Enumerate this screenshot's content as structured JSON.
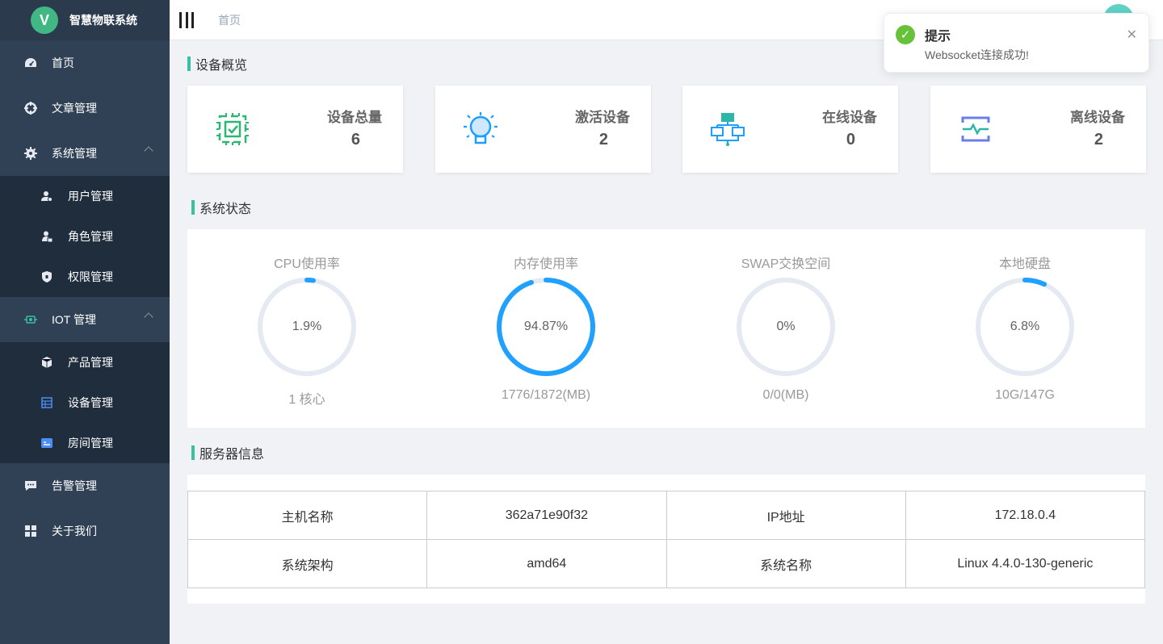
{
  "app": {
    "logo_letter": "V",
    "title": "智慧物联系统"
  },
  "sidebar": {
    "items": [
      {
        "label": "首页",
        "icon": "dashboard-icon"
      },
      {
        "label": "文章管理",
        "icon": "target-icon"
      },
      {
        "label": "系统管理",
        "icon": "gear-icon",
        "expanded": true,
        "children": [
          {
            "label": "用户管理",
            "icon": "user-icon"
          },
          {
            "label": "角色管理",
            "icon": "role-icon"
          },
          {
            "label": "权限管理",
            "icon": "shield-icon"
          }
        ]
      },
      {
        "label": "IOT 管理",
        "icon": "iot-icon",
        "expanded": true,
        "children": [
          {
            "label": "产品管理",
            "icon": "product-icon"
          },
          {
            "label": "设备管理",
            "icon": "device-icon"
          },
          {
            "label": "房间管理",
            "icon": "room-icon"
          }
        ]
      },
      {
        "label": "告警管理",
        "icon": "chat-icon"
      },
      {
        "label": "关于我们",
        "icon": "grid-icon"
      }
    ]
  },
  "navbar": {
    "breadcrumb": "首页"
  },
  "overview": {
    "title": "设备概览",
    "cards": [
      {
        "label": "设备总量",
        "value": "6",
        "icon": "chip-icon",
        "color": "#2bb673"
      },
      {
        "label": "激活设备",
        "value": "2",
        "icon": "bulb-icon",
        "color": "#1e9fff"
      },
      {
        "label": "在线设备",
        "value": "0",
        "icon": "network-icon",
        "color": "#2bb6a8"
      },
      {
        "label": "离线设备",
        "value": "2",
        "icon": "pulse-icon",
        "color": "#6a7ee8"
      }
    ]
  },
  "status": {
    "title": "系统状态",
    "gauges": [
      {
        "label": "CPU使用率",
        "center": "1.9%",
        "percent": 1.9,
        "footer": "1 核心"
      },
      {
        "label": "内存使用率",
        "center": "94.87%",
        "percent": 94.87,
        "footer": "1776/1872(MB)"
      },
      {
        "label": "SWAP交换空间",
        "center": "0%",
        "percent": 0,
        "footer": "0/0(MB)"
      },
      {
        "label": "本地硬盘",
        "center": "6.8%",
        "percent": 6.8,
        "footer": "10G/147G"
      }
    ],
    "colors": {
      "track": "#e5e9f2",
      "fill": "#20a0ff"
    }
  },
  "server": {
    "title": "服务器信息",
    "rows": [
      [
        "主机名称",
        "362a71e90f32",
        "IP地址",
        "172.18.0.4"
      ],
      [
        "系统架构",
        "amd64",
        "系统名称",
        "Linux 4.4.0-130-generic"
      ]
    ]
  },
  "notification": {
    "title": "提示",
    "message": "Websocket连接成功!",
    "icon": "success-check-icon"
  }
}
